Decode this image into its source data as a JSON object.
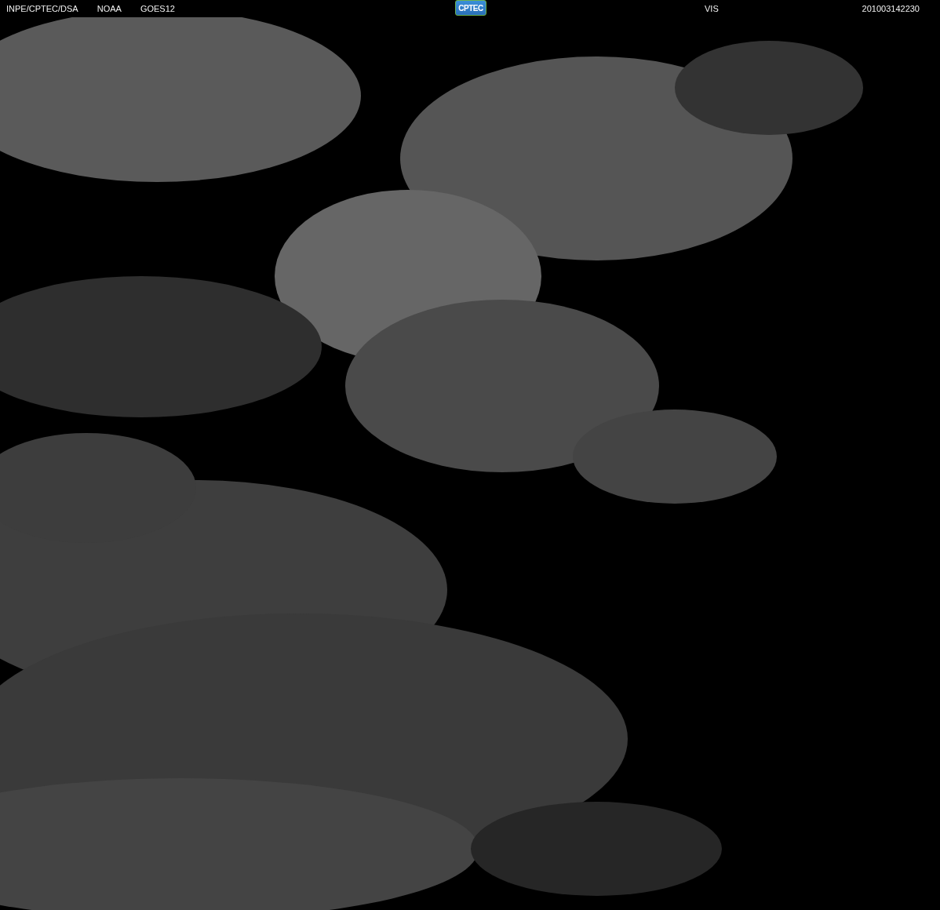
{
  "header": {
    "source": "INPE/CPTEC/DSA",
    "agency": "NOAA",
    "satellite": "GOES12",
    "logo_text": "CPTEC",
    "channel": "VIS",
    "timestamp": "201003142230"
  }
}
